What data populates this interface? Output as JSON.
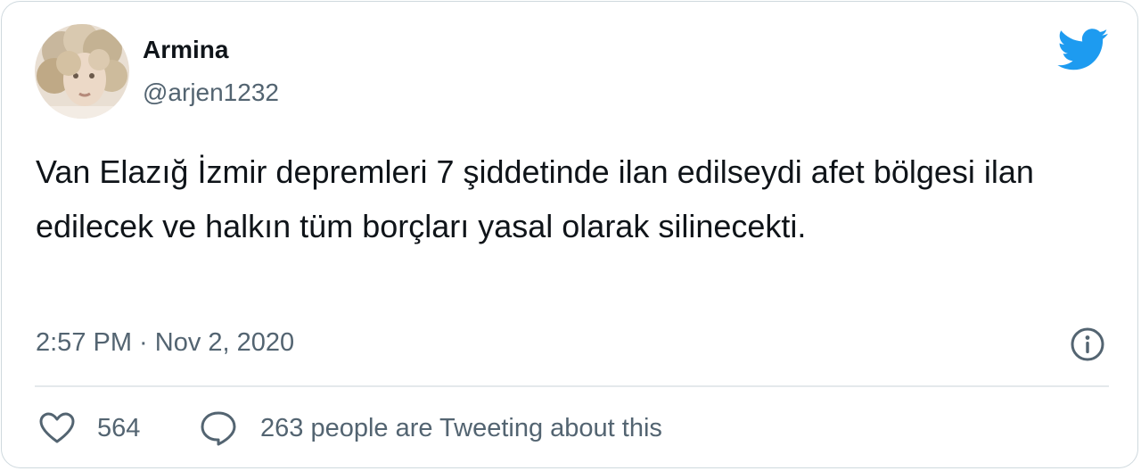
{
  "author": {
    "name": "Armina",
    "handle": "@arjen1232"
  },
  "tweet": {
    "text": "Van Elazığ İzmir depremleri 7 şiddetinde ilan edilseydi afet bölgesi ilan edilecek ve halkın tüm borçları yasal olarak silinecekti.",
    "timestamp": "2:57 PM · Nov 2, 2020"
  },
  "actions": {
    "likes": "564",
    "conversation": "263 people are Tweeting about this"
  },
  "icons": {
    "brand": "twitter-bird-icon",
    "info": "info-icon",
    "like": "heart-icon",
    "reply": "speech-bubble-icon"
  },
  "colors": {
    "twitter_blue": "#1d9bf0",
    "text_primary": "#0f1419",
    "text_secondary": "#536471",
    "border": "#cfd9de"
  }
}
